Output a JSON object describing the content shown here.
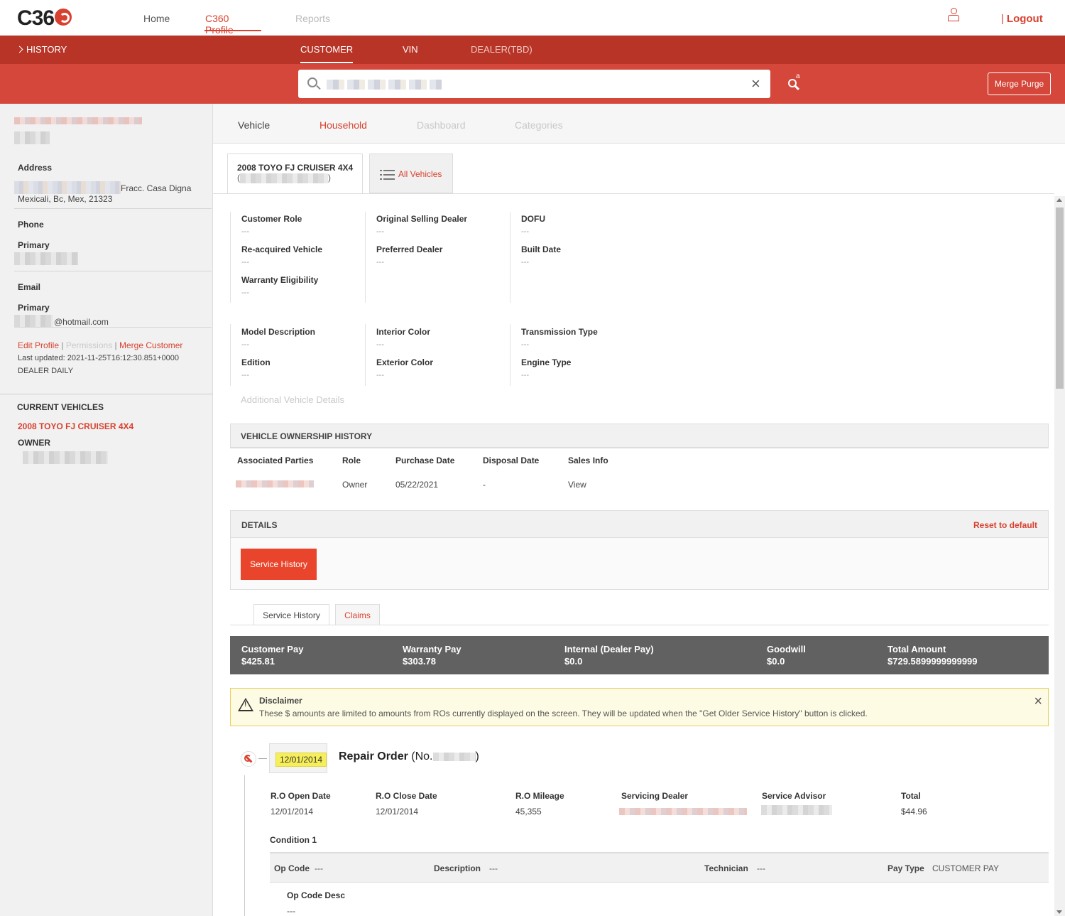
{
  "app": {
    "logo": "C36",
    "nav": [
      "Home",
      "C360 Profile",
      "Reports"
    ],
    "logout": "Logout",
    "logout_sep": "|"
  },
  "subnav": {
    "history": "HISTORY",
    "tabs": [
      "CUSTOMER",
      "VIN",
      "DEALER(TBD)"
    ]
  },
  "search": {
    "value": "",
    "clear": "×",
    "advanced_icon_letter": "a",
    "merge_purge": "Merge Purge"
  },
  "sidebar": {
    "address_label": "Address",
    "address_line1_suffix": "Fracc. Casa Digna",
    "address_line2": "Mexicali, Bc, Mex, 21323",
    "phone_label": "Phone",
    "phone_primary_label": "Primary",
    "email_label": "Email",
    "email_primary_label": "Primary",
    "email_suffix": "@hotmail.com",
    "links": {
      "edit_profile": "Edit Profile",
      "permissions": "Permissions",
      "merge_customer": "Merge Customer",
      "sep": "|"
    },
    "last_updated": "Last updated: 2021-11-25T16:12:30.851+0000",
    "source": "DEALER DAILY",
    "current_vehicles_label": "CURRENT VEHICLES",
    "vehicle_name": "2008 TOYO FJ CRUISER 4X4",
    "owner_label": "OWNER"
  },
  "profile_tabs": [
    "Vehicle",
    "Household",
    "Dashboard",
    "Categories"
  ],
  "vehicle_tabs": {
    "selected_title": "2008 TOYO FJ CRUISER 4X4",
    "selected_sub_open": "(",
    "selected_sub_close": ")",
    "all_vehicles": "All Vehicles"
  },
  "fields": {
    "customer_role": {
      "label": "Customer Role",
      "value": "---"
    },
    "reacquired": {
      "label": "Re-acquired Vehicle",
      "value": "---"
    },
    "warranty": {
      "label": "Warranty Eligibility",
      "value": "---"
    },
    "orig_dealer": {
      "label": "Original Selling Dealer",
      "value": "---"
    },
    "pref_dealer": {
      "label": "Preferred Dealer",
      "value": "---"
    },
    "dofu": {
      "label": "DOFU",
      "value": "---"
    },
    "built_date": {
      "label": "Built Date",
      "value": "---"
    },
    "model_desc": {
      "label": "Model Description",
      "value": "---"
    },
    "edition": {
      "label": "Edition",
      "value": "---"
    },
    "interior": {
      "label": "Interior Color",
      "value": "---"
    },
    "exterior": {
      "label": "Exterior Color",
      "value": "---"
    },
    "transmission": {
      "label": "Transmission Type",
      "value": "---"
    },
    "engine": {
      "label": "Engine Type",
      "value": "---"
    }
  },
  "additional_details": "Additional Vehicle Details",
  "ownership": {
    "title": "VEHICLE OWNERSHIP HISTORY",
    "headers": [
      "Associated Parties",
      "Role",
      "Purchase Date",
      "Disposal Date",
      "Sales Info"
    ],
    "row": {
      "role": "Owner",
      "purchase": "05/22/2021",
      "disposal": "-",
      "sales": "View"
    }
  },
  "details": {
    "title": "DETAILS",
    "reset": "Reset to default",
    "service_history_btn": "Service History"
  },
  "history_tabs": [
    "Service History",
    "Claims"
  ],
  "totals": [
    {
      "label": "Customer Pay",
      "value": "$425.81"
    },
    {
      "label": "Warranty Pay",
      "value": "$303.78"
    },
    {
      "label": "Internal (Dealer Pay)",
      "value": "$0.0"
    },
    {
      "label": "Goodwill",
      "value": "$0.0"
    },
    {
      "label": "Total Amount",
      "value": "$729.5899999999999"
    }
  ],
  "disclaimer": {
    "title": "Disclaimer",
    "message": "These $ amounts are limited to amounts from ROs currently displayed on the screen. They will be updated when the \"Get Older Service History\" button is clicked.",
    "close": "×"
  },
  "repair_order": {
    "date": "12/01/2014",
    "title": "Repair Order",
    "no_open": "(No.",
    "no_close": ")",
    "open_date_label": "R.O Open Date",
    "open_date": "12/01/2014",
    "close_date_label": "R.O Close Date",
    "close_date": "12/01/2014",
    "mileage_label": "R.O Mileage",
    "mileage": "45,355",
    "dealer_label": "Servicing Dealer",
    "advisor_label": "Service Advisor",
    "total_label": "Total",
    "total": "$44.96",
    "condition": "Condition 1",
    "op_code_label": "Op Code",
    "op_code": "---",
    "description_label": "Description",
    "description": "---",
    "technician_label": "Technician",
    "technician": "---",
    "pay_type_label": "Pay Type",
    "pay_type": "CUSTOMER PAY",
    "op_code_desc_label": "Op Code Desc",
    "op_code_desc": "---"
  }
}
